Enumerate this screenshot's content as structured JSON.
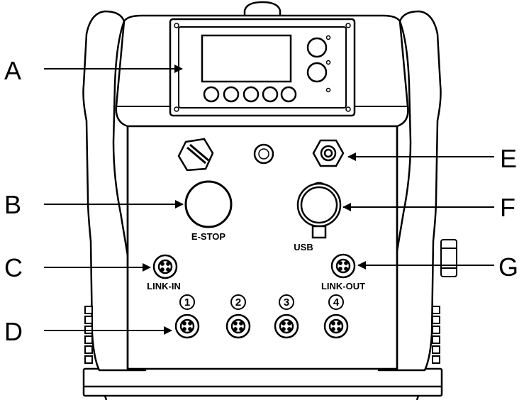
{
  "callouts": {
    "a": "A",
    "b": "B",
    "c": "C",
    "d": "D",
    "e": "E",
    "f": "F",
    "g": "G"
  },
  "panel_labels": {
    "estop": "E-STOP",
    "usb": "USB",
    "link_in": "LINK-IN",
    "link_out": "LINK-OUT"
  },
  "port_numbers": [
    "1",
    "2",
    "3",
    "4"
  ],
  "colors": {
    "line": "#000000",
    "fill": "#ffffff",
    "screen": "#ffffff"
  }
}
